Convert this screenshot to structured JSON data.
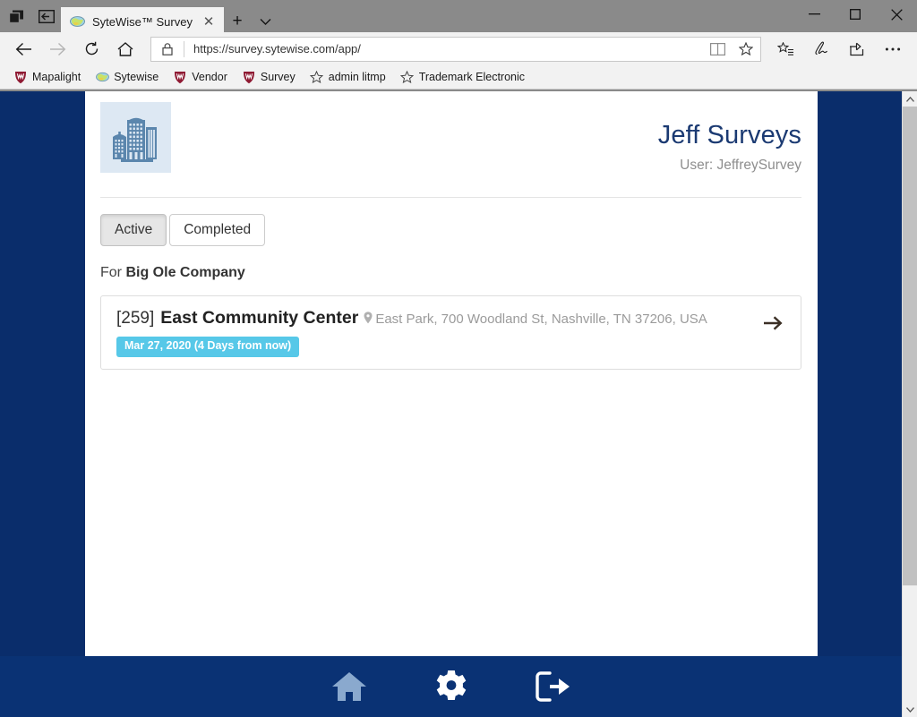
{
  "browser": {
    "window_icons": [
      "task-view-icon",
      "set-tabs-aside-icon"
    ],
    "tab": {
      "title": "SyteWise™ Survey",
      "favicon": "globe-favicon",
      "close_label": "✕"
    },
    "new_tab_label": "+",
    "tab_list_label": "∨",
    "window_controls": {
      "minimize": "—",
      "maximize": "□",
      "close": "✕"
    },
    "nav": {
      "back": "back-arrow",
      "forward": "forward-arrow",
      "refresh": "refresh-arrow",
      "home": "home-outline"
    },
    "address": {
      "url": "https://survey.sytewise.com/app/",
      "lock": "padlock-icon",
      "reading_view": "book-icon",
      "favorite": "star-outline-icon"
    },
    "toolbar_right": [
      "favorites-hub-icon",
      "web-notes-icon",
      "share-icon",
      "more-icon"
    ],
    "bookmarks": [
      {
        "label": "Mapalight",
        "icon": "w-crest-icon"
      },
      {
        "label": "Sytewise",
        "icon": "globe-favicon"
      },
      {
        "label": "Vendor",
        "icon": "w-crest-icon"
      },
      {
        "label": "Survey",
        "icon": "w-crest-icon"
      },
      {
        "label": "admin litmp",
        "icon": "star-outline-icon"
      },
      {
        "label": "Trademark Electronic",
        "icon": "star-outline-icon"
      }
    ]
  },
  "app": {
    "logo": "office-buildings-icon",
    "title": "Jeff Surveys",
    "user_line": "User: JeffreySurvey",
    "tabs": [
      {
        "label": "Active",
        "active": true
      },
      {
        "label": "Completed",
        "active": false
      }
    ],
    "for_prefix": "For ",
    "for_company": "Big Ole Company",
    "surveys": [
      {
        "id": "[259]",
        "name": "East Community Center",
        "address": "East Park, 700 Woodland St, Nashville, TN 37206, USA",
        "badge": "Mar 27, 2020 (4 Days from now)",
        "arrow": "right-arrow-icon"
      }
    ],
    "bottom_nav": [
      {
        "name": "home-icon",
        "label": "Home"
      },
      {
        "name": "settings-gear-icon",
        "label": "Settings"
      },
      {
        "name": "logout-icon",
        "label": "Log out"
      }
    ]
  },
  "scrollbar": {
    "up": "▲",
    "down": "▼"
  },
  "colors": {
    "page_background": "#0a2d6b",
    "bottom_nav": "#0a3274",
    "title": "#1b3a72",
    "badge": "#57c8e8",
    "logo_tile": "#dde8f3",
    "logo_glyph": "#5b86ad"
  }
}
